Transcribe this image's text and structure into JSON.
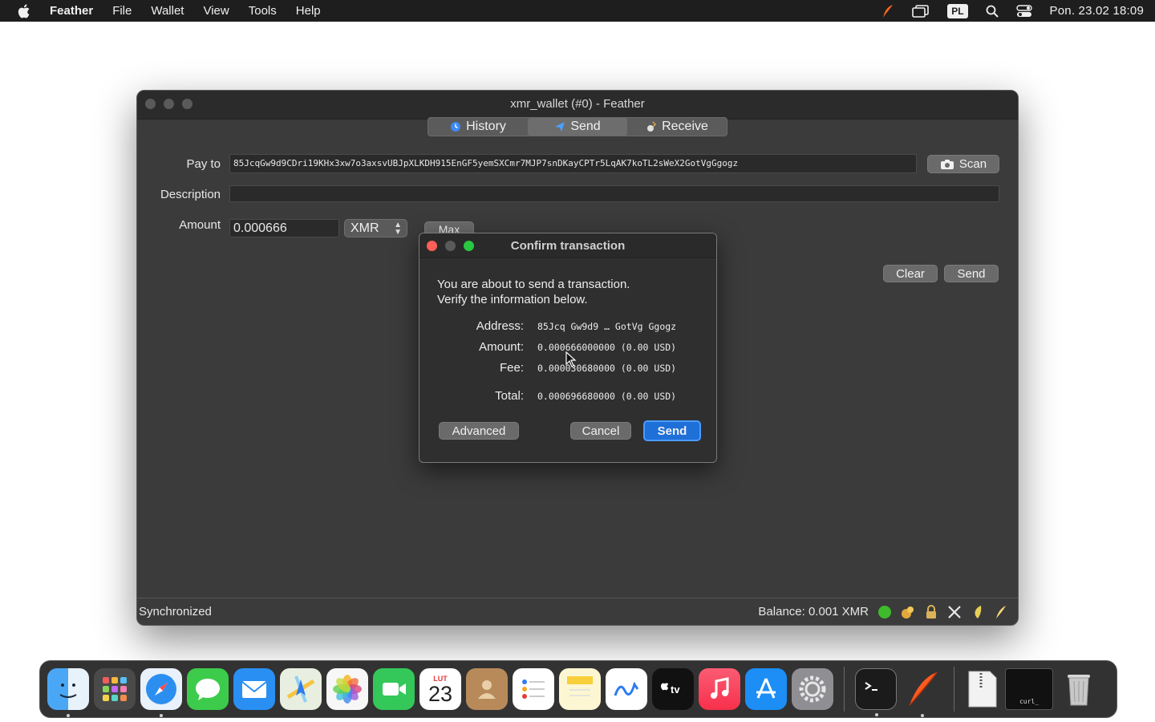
{
  "menubar": {
    "app_name": "Feather",
    "items": [
      "File",
      "Wallet",
      "View",
      "Tools",
      "Help"
    ],
    "input_source": "PL",
    "clock": "Pon. 23.02  18:09"
  },
  "window": {
    "title": "xmr_wallet (#0) - Feather",
    "tabs": [
      {
        "label": "History",
        "icon": "history-icon"
      },
      {
        "label": "Send",
        "icon": "send-icon"
      },
      {
        "label": "Receive",
        "icon": "receive-icon"
      }
    ],
    "form": {
      "pay_to_label": "Pay to",
      "pay_to_value": "85JcqGw9d9CDri19KHx3xw7o3axsvUBJpXLKDH915EnGF5yemSXCmr7MJP7snDKayCPTr5LqAK7koTL2sWeX2GotVgGgogz",
      "scan_label": "Scan",
      "description_label": "Description",
      "description_value": "",
      "amount_label": "Amount",
      "amount_value": "0.000666",
      "currency": "XMR",
      "max_label": "Max",
      "clear_label": "Clear",
      "send_label": "Send"
    },
    "status": {
      "sync": "Synchronized",
      "balance": "Balance: 0.001 XMR"
    }
  },
  "dialog": {
    "title": "Confirm transaction",
    "intro_line1": "You are about to send a transaction.",
    "intro_line2": "Verify the information below.",
    "rows": [
      {
        "label": "Address:",
        "value": "85Jcq Gw9d9 … GotVg Ggogz"
      },
      {
        "label": "Amount:",
        "value": "0.000666000000 (0.00 USD)"
      },
      {
        "label": "Fee:",
        "value": "0.000030680000 (0.00 USD)"
      },
      {
        "label": "Total:",
        "value": "0.000696680000 (0.00 USD)"
      }
    ],
    "advanced_label": "Advanced",
    "cancel_label": "Cancel",
    "send_label": "Send"
  },
  "dock": {
    "calendar_month": "LUT",
    "calendar_day": "23",
    "terminal_label": "curl_"
  },
  "colors": {
    "accent": "#1f6fd8",
    "window_bg": "#3b3b3b",
    "close_red": "#ff5f57",
    "zoom_green": "#28c840"
  }
}
